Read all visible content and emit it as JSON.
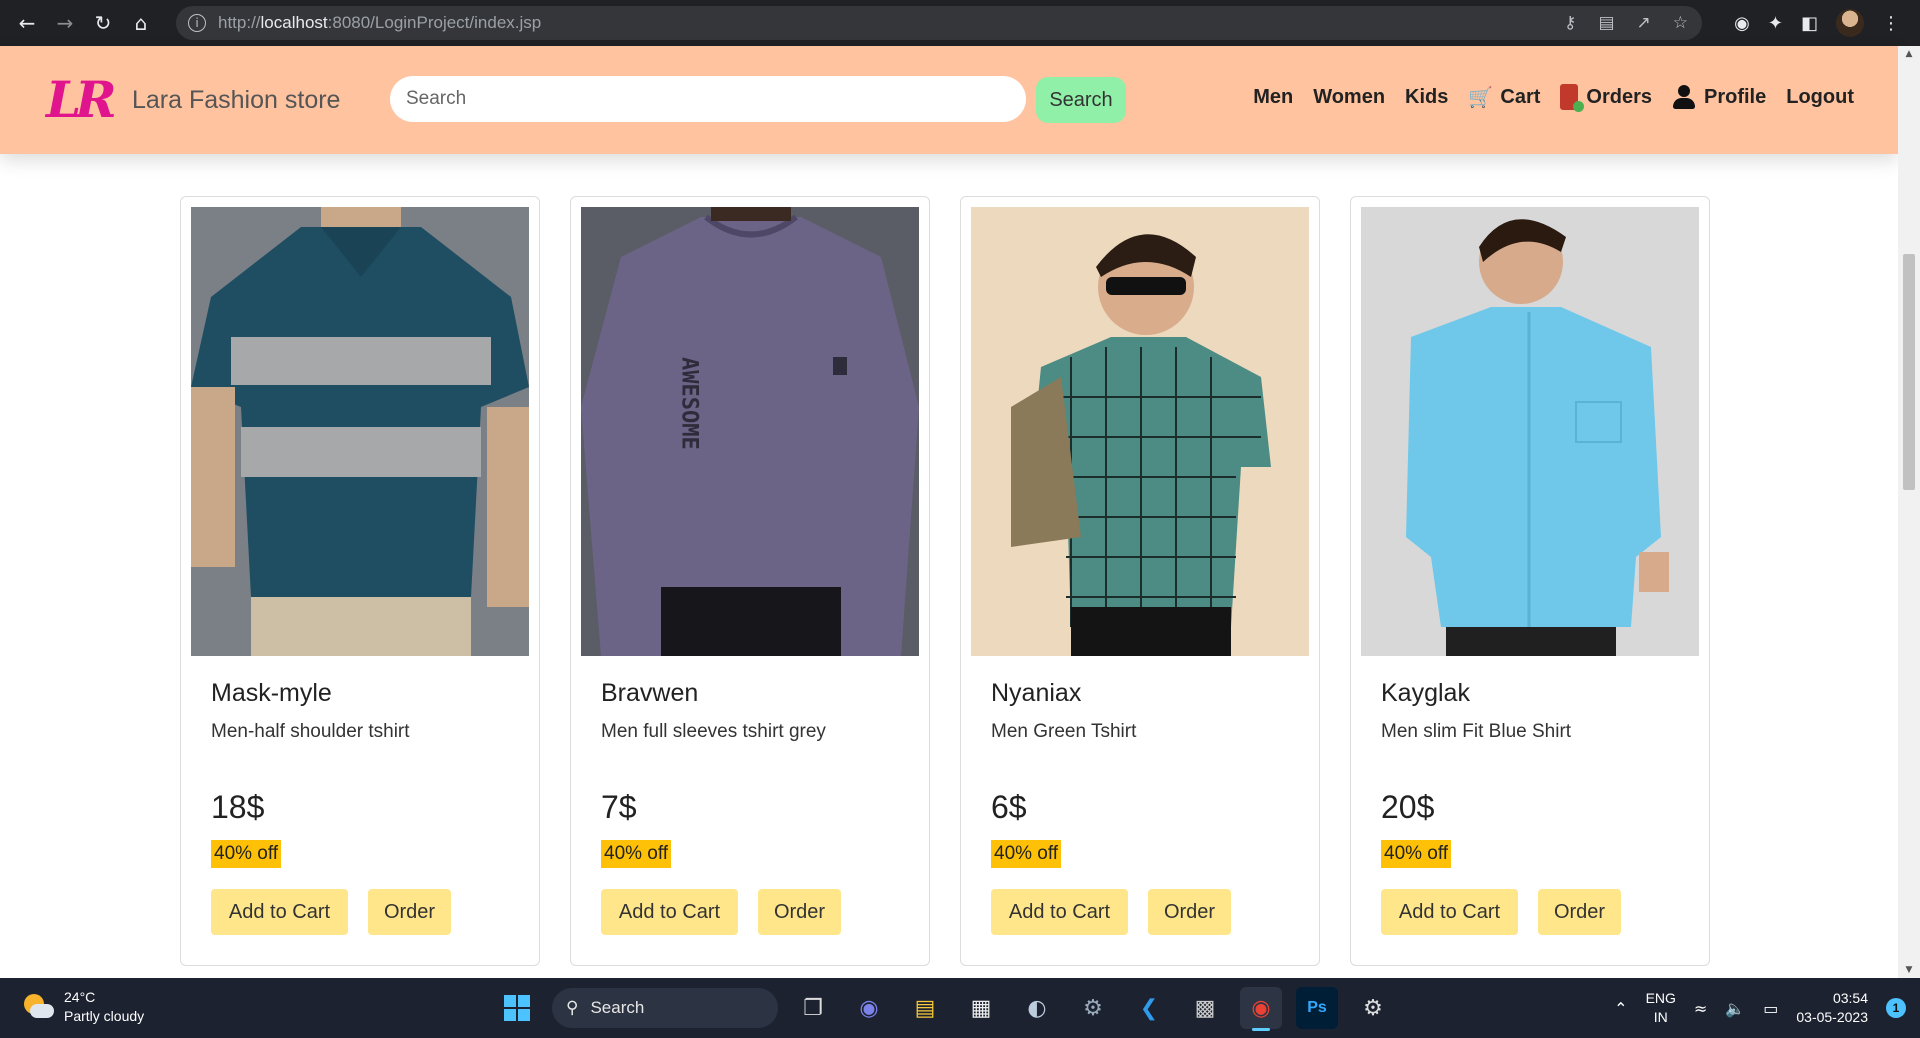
{
  "browser": {
    "url_prefix": "http://",
    "url_host": "localhost",
    "url_rest": ":8080/LoginProject/index.jsp"
  },
  "header": {
    "logo_text": "LR",
    "brand_name": "Lara Fashion store",
    "search_placeholder": "Search",
    "search_button": "Search",
    "menu": {
      "men": "Men",
      "women": "Women",
      "kids": "Kids",
      "cart": "Cart",
      "orders": "Orders",
      "profile": "Profile",
      "logout": "Logout"
    }
  },
  "products": [
    {
      "title": "Mask-myle",
      "description": "Men-half shoulder tshirt",
      "price": "18$",
      "discount": "40% off",
      "add_to_cart": "Add to Cart",
      "order": "Order"
    },
    {
      "title": "Bravwen",
      "description": "Men full sleeves tshirt grey",
      "price": "7$",
      "discount": "40% off",
      "add_to_cart": "Add to Cart",
      "order": "Order"
    },
    {
      "title": "Nyaniax",
      "description": "Men Green Tshirt",
      "price": "6$",
      "discount": "40% off",
      "add_to_cart": "Add to Cart",
      "order": "Order"
    },
    {
      "title": "Kayglak",
      "description": "Men slim Fit Blue Shirt",
      "price": "20$",
      "discount": "40% off",
      "add_to_cart": "Add to Cart",
      "order": "Order"
    }
  ],
  "shirt_print": {
    "word": "AWESOME"
  },
  "colors": {
    "header_bg": "#ffc3a0",
    "search_btn": "#90f0a8",
    "discount_badge": "#ffc107",
    "card_button": "#ffe68a",
    "logo": "#e0148c"
  },
  "taskbar": {
    "temperature": "24°C",
    "weather": "Partly cloudy",
    "search_label": "Search",
    "lang_top": "ENG",
    "lang_bottom": "IN",
    "time": "03:54",
    "date": "03-05-2023",
    "notification_count": "1",
    "ps_label": "Ps"
  }
}
